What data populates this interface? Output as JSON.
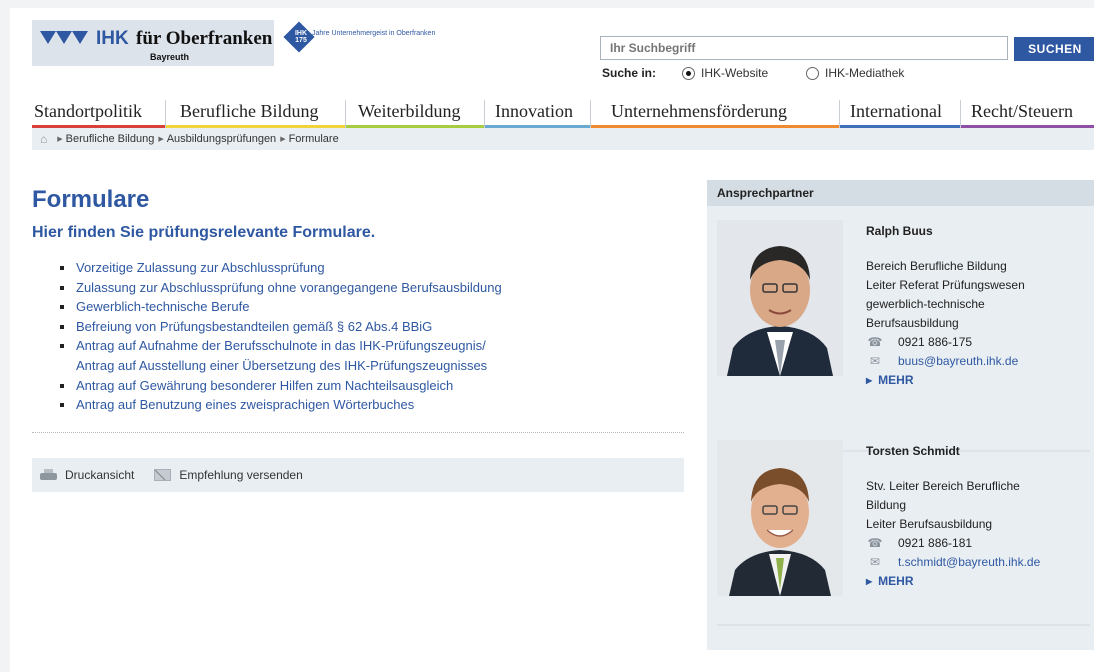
{
  "header": {
    "logo_ihk": "IHK",
    "logo_region": "für Oberfranken",
    "logo_city": "Bayreuth",
    "jubilee_badge": "IHK 175",
    "jubilee_text": "Jahre Unternehmergeist in Oberfranken",
    "search_placeholder": "Ihr Suchbegriff",
    "search_button": "SUCHEN",
    "search_in_label": "Suche in:",
    "search_scopes": [
      "IHK-Website",
      "IHK-Mediathek"
    ],
    "search_scope_selected": "IHK-Website"
  },
  "nav": {
    "items": [
      {
        "label": "Standortpolitik",
        "color": "#d9403a"
      },
      {
        "label": "Berufliche Bildung",
        "color": "#f1d33b"
      },
      {
        "label": "Weiterbildung",
        "color": "#a9cd41"
      },
      {
        "label": "Innovation",
        "color": "#6aa9d1"
      },
      {
        "label": "Unternehmensförderung",
        "color": "#ef8a2f"
      },
      {
        "label": "International",
        "color": "#3e6fb8"
      },
      {
        "label": "Recht/Steuern",
        "color": "#8f4fa4"
      }
    ]
  },
  "breadcrumb": [
    "Berufliche Bildung",
    "Ausbildungsprüfungen",
    "Formulare"
  ],
  "main": {
    "title": "Formulare",
    "lead": "Hier finden Sie prüfungsrelevante Formulare.",
    "links": [
      "Vorzeitige Zulassung zur Abschlussprüfung",
      "Zulassung zur Abschlussprüfung ohne vorangegangene Berufsausbildung",
      "Gewerblich-technische Berufe",
      "Befreiung von Prüfungsbestandteilen gemäß § 62 Abs.4 BBiG",
      "Antrag auf Aufnahme der Berufsschulnote in das IHK-Prüfungszeugnis/",
      "Antrag auf Ausstellung einer Übersetzung des IHK-Prüfungszeugnisses",
      "Antrag auf Gewährung besonderer Hilfen zum Nachteilsausgleich",
      "Antrag auf Benutzung eines zweisprachigen Wörterbuches"
    ],
    "tools": {
      "print": "Druckansicht",
      "recommend": "Empfehlung versenden"
    }
  },
  "aside": {
    "heading": "Ansprechpartner",
    "contacts": [
      {
        "name": "Ralph Buus",
        "desc": [
          "Bereich Berufliche Bildung",
          "Leiter Referat Prüfungswesen",
          "gewerblich-technische",
          "Berufsausbildung"
        ],
        "phone": "0921 886-175",
        "email": "buus@bayreuth.ihk.de",
        "more": "MEHR"
      },
      {
        "name": "Torsten Schmidt",
        "desc": [
          "Stv. Leiter Bereich Berufliche",
          "Bildung",
          "Leiter Berufsausbildung"
        ],
        "phone": "0921 886-181",
        "email": "t.schmidt@bayreuth.ihk.de",
        "more": "MEHR"
      }
    ]
  }
}
